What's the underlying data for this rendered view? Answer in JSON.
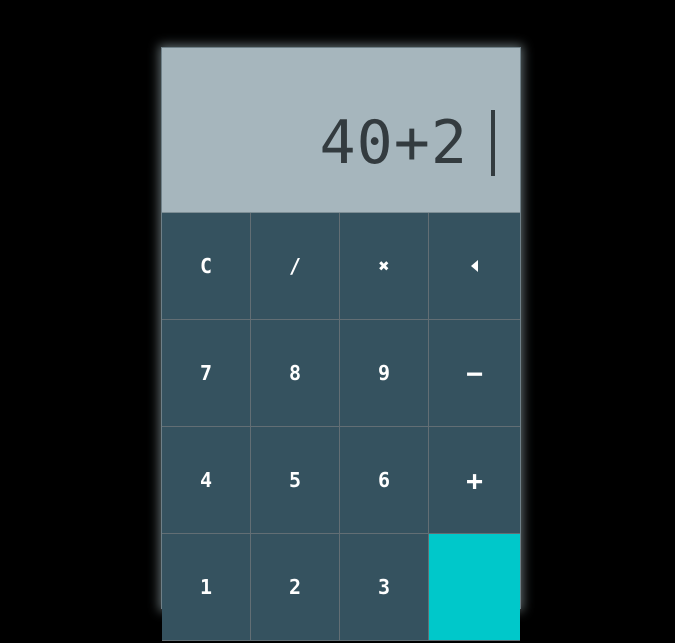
{
  "display": {
    "expression": "40+2"
  },
  "keys": {
    "clear": "C",
    "divide": "/",
    "multiply": "✖",
    "backspace_icon": "backspace-icon",
    "seven": "7",
    "eight": "8",
    "nine": "9",
    "minus": "−",
    "four": "4",
    "five": "5",
    "six": "6",
    "plus": "+",
    "one": "1",
    "two": "2",
    "three": "3",
    "equals": ""
  },
  "colors": {
    "background": "#000000",
    "display_bg": "#a6b6bd",
    "key_bg": "#35525f",
    "accent": "#00c8ca",
    "text_dark": "#333b3f",
    "text_light": "#ffffff"
  }
}
